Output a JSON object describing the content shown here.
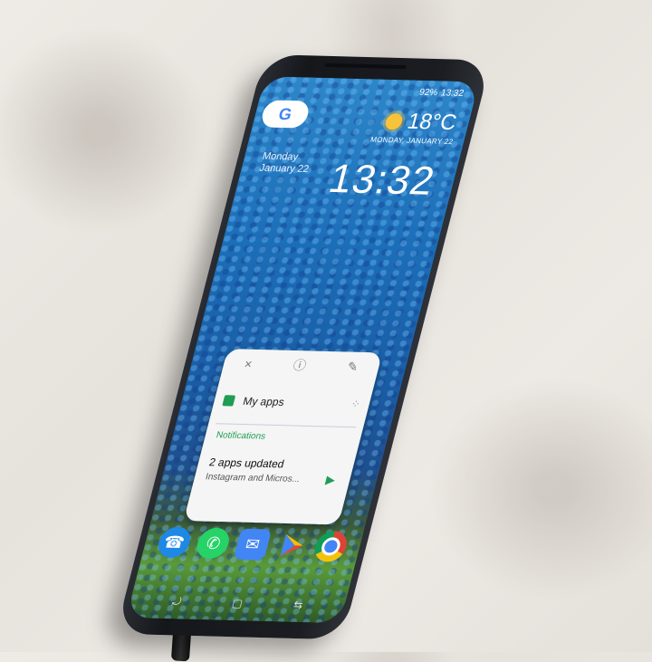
{
  "status": {
    "battery": "92%",
    "time": "13:32"
  },
  "date_widget": {
    "day": "Monday",
    "date": "January 22"
  },
  "weather": {
    "temperature": "18°C",
    "date": "MONDAY, JANUARY 22"
  },
  "clock": {
    "time": "13:32"
  },
  "card": {
    "close_symbol": "×",
    "info_symbol": "ⓘ",
    "edit_symbol": "✎",
    "my_apps": "My apps",
    "section_label": "Notifications",
    "notif_title": "2 apps updated",
    "notif_sub": "Instagram and Micros..."
  },
  "icons": {
    "google": "G",
    "phone": "☎",
    "whatsapp": "✆",
    "inbox": "✉",
    "play": "▶",
    "nav_recent": "⤾",
    "nav_home": "▢",
    "nav_back": "⇆"
  },
  "colors": {
    "accent_green": "#1f9d55",
    "google_blue": "#4285f4"
  }
}
